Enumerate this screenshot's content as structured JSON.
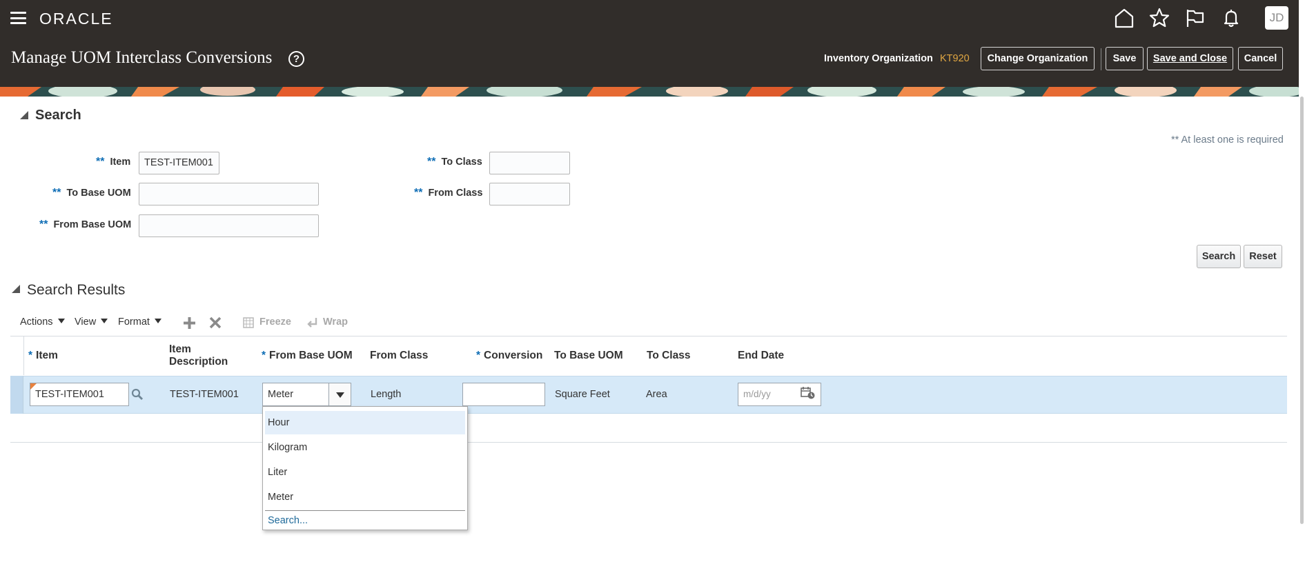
{
  "app": {
    "logo": "ORACLE",
    "avatar_initials": "JD"
  },
  "header": {
    "title": "Manage UOM Interclass Conversions",
    "help_glyph": "?",
    "org_label": "Inventory Organization",
    "org_value": "KT920",
    "buttons": {
      "change_org": "Change Organization",
      "save": "Save",
      "save_close": "Save and Close",
      "cancel": "Cancel"
    }
  },
  "search": {
    "title": "Search",
    "required_note": "** At least one is required",
    "required_marker": "**",
    "fields": {
      "item": {
        "label": "Item",
        "value": "TEST-ITEM001"
      },
      "to_base_uom": {
        "label": "To Base UOM",
        "value": ""
      },
      "from_base_uom": {
        "label": "From Base UOM",
        "value": ""
      },
      "to_class": {
        "label": "To Class",
        "value": ""
      },
      "from_class": {
        "label": "From Class",
        "value": ""
      }
    },
    "search_button": "Search",
    "reset_button": "Reset"
  },
  "results": {
    "title": "Search Results",
    "toolbar": {
      "actions": "Actions",
      "view": "View",
      "format": "Format",
      "freeze": "Freeze",
      "wrap": "Wrap"
    },
    "required_marker": "*",
    "columns": {
      "item": "Item",
      "item_desc_1": "Item",
      "item_desc_2": "Description",
      "from_base_uom": "From Base UOM",
      "from_class": "From Class",
      "conversion": "Conversion",
      "to_base_uom": "To Base UOM",
      "to_class": "To Class",
      "end_date": "End Date"
    },
    "row": {
      "item": "TEST-ITEM001",
      "item_description": "TEST-ITEM001",
      "from_base_uom": "Meter",
      "from_class": "Length",
      "conversion": "",
      "to_base_uom": "Square Feet",
      "to_class": "Area",
      "end_date_placeholder": "m/d/yy"
    },
    "dropdown": {
      "options": [
        "Hour",
        "Kilogram",
        "Liter",
        "Meter"
      ],
      "search_link": "Search..."
    }
  },
  "colors": {
    "header_bg": "#312d2a",
    "accent_org": "#e1a742",
    "required_star": "#0e6db5",
    "selected_row": "#d6e9f8"
  }
}
